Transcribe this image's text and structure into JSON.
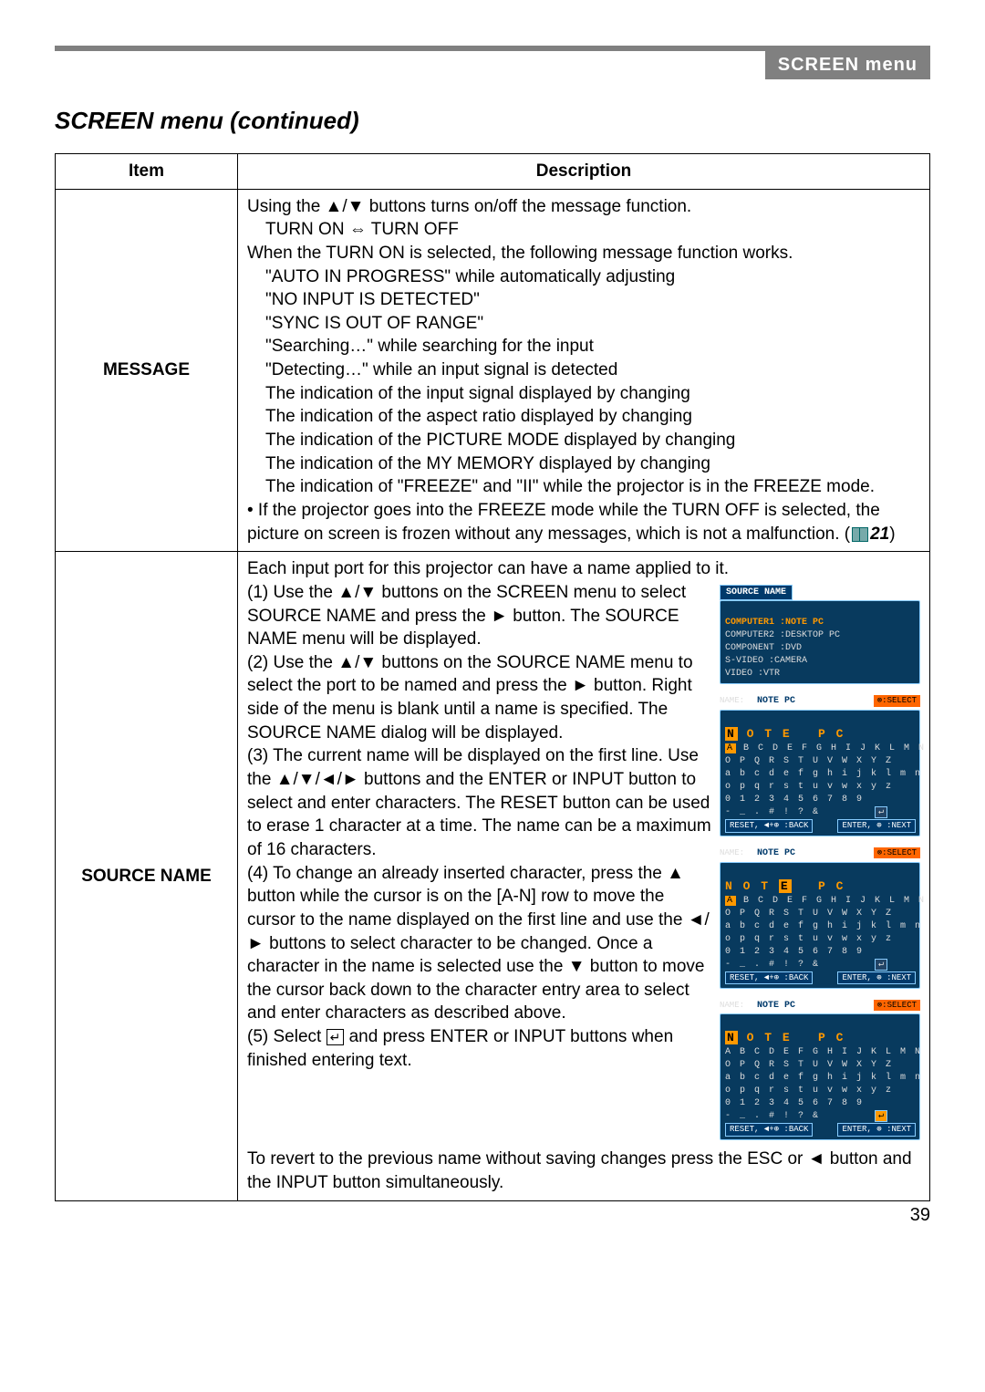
{
  "header": {
    "bar": "SCREEN menu"
  },
  "section_title": "SCREEN menu (continued)",
  "table": {
    "headers": {
      "item": "Item",
      "desc": "Description"
    },
    "rows": [
      {
        "item": "MESSAGE",
        "desc": {
          "p1": "Using the ▲/▼ buttons turns on/off the message function.",
          "p2": "TURN ON ⇔ TURN OFF",
          "p3": "When the TURN ON is selected, the following message function works.",
          "lines": [
            "\"AUTO IN PROGRESS\" while automatically adjusting",
            "\"NO INPUT IS DETECTED\"",
            "\"SYNC IS OUT OF RANGE\"",
            "\"Searching…\" while searching for the input",
            "\"Detecting…\" while an input signal is detected",
            "The indication of the input signal displayed by changing",
            "The indication of the aspect ratio displayed by changing",
            "The indication of the PICTURE MODE displayed by changing",
            "The indication of the MY MEMORY displayed by changing",
            "The indication of \"FREEZE\" and \"II\" while the projector is in the FREEZE mode."
          ],
          "note_a": "• If the projector goes into the FREEZE mode while the TURN OFF is selected, the picture on screen is frozen without any messages, which is not a malfunction. (",
          "note_ref": "21",
          "note_b": ")"
        }
      },
      {
        "item": "SOURCE NAME",
        "desc": {
          "intro": "Each input port for this projector can have a name applied to it.",
          "s1": "(1) Use the ▲/▼ buttons on the SCREEN menu to select SOURCE NAME and press the ► button. The SOURCE NAME menu will be displayed.",
          "s2": "(2) Use the ▲/▼ buttons on the SOURCE NAME menu to select the port to be named and press the ► button. Right side of the menu is blank until a name is specified. The SOURCE NAME dialog will be displayed.",
          "s3": "(3) The current name will be displayed on the first line. Use the ▲/▼/◄/► buttons and the ENTER or INPUT button to select and enter characters. The RESET button can be used to erase 1 character at a time. The name can be a maximum of 16 characters.",
          "s4": "(4) To change an already inserted character, press the ▲ button while the cursor is on the [A-N] row to move the cursor to the name displayed on the first line and use the ◄/► buttons to select character to be changed. Once a character in the name is selected use the ▼ button to move the cursor back down to the character entry area to select and enter characters as described above.",
          "s5a": "(5) Select ",
          "s5b": " and press ENTER or INPUT buttons when finished entering text.",
          "outro": "To revert to the previous name without saving changes press the ESC or ◄ button and the INPUT button simultaneously."
        },
        "osd": {
          "menu_title": "SOURCE NAME",
          "menu_lines": [
            "COMPUTER1 :NOTE PC",
            "COMPUTER2 :DESKTOP PC",
            "COMPONENT :DVD",
            "S-VIDEO :CAMERA",
            "VIDEO :VTR"
          ],
          "name_label": "NAME:",
          "current_name": "NOTE PC",
          "select_tag": "⊗:SELECT",
          "big1": "N O T E   P C",
          "row1": "A B C D E F G H I J K L M N",
          "row2": "O P Q R S T U V W X Y Z",
          "row3": "a b c d e f g h i j k l m n",
          "row4": "o p q r s t u v w x y z",
          "row5": "0 1 2 3 4 5 6 7 8 9",
          "row6": "- _ . # ! ? &",
          "foot_reset": "RESET, ◄+⊕ :BACK",
          "foot_enter": "ENTER, ⊕ :NEXT",
          "big2": "N O T E   P C",
          "big2_cursor_char": "E",
          "big3": "N O T E   P C"
        }
      }
    ]
  },
  "page_number": "39"
}
